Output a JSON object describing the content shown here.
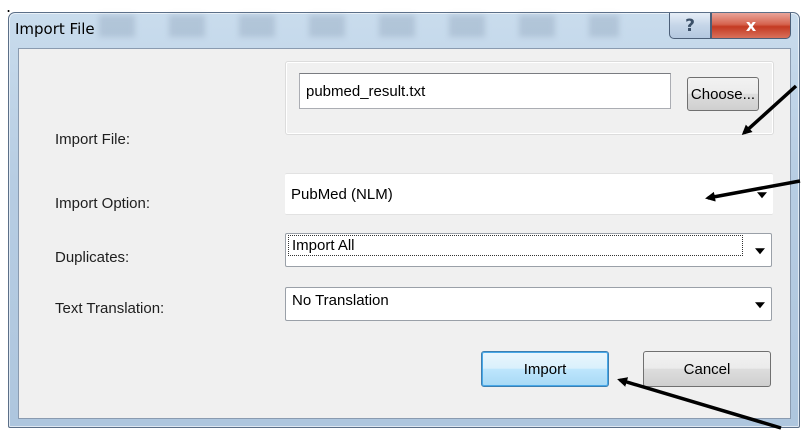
{
  "dialog": {
    "title": "Import File",
    "help_glyph": "?",
    "close_glyph": "x"
  },
  "fields": {
    "import_file": {
      "label": "Import File:",
      "value": "pubmed_result.txt",
      "choose_label": "Choose..."
    },
    "import_option": {
      "label": "Import Option:",
      "value": "PubMed (NLM)"
    },
    "duplicates": {
      "label": "Duplicates:",
      "value": "Import All"
    },
    "text_translation": {
      "label": "Text Translation:",
      "value": "No Translation"
    }
  },
  "buttons": {
    "import_label": "Import",
    "cancel_label": "Cancel"
  },
  "leading_mark": ".",
  "colors": {
    "close_button": "#c43a22",
    "default_button_border": "#3c7fb1",
    "annotation_arrow": "#000000"
  }
}
